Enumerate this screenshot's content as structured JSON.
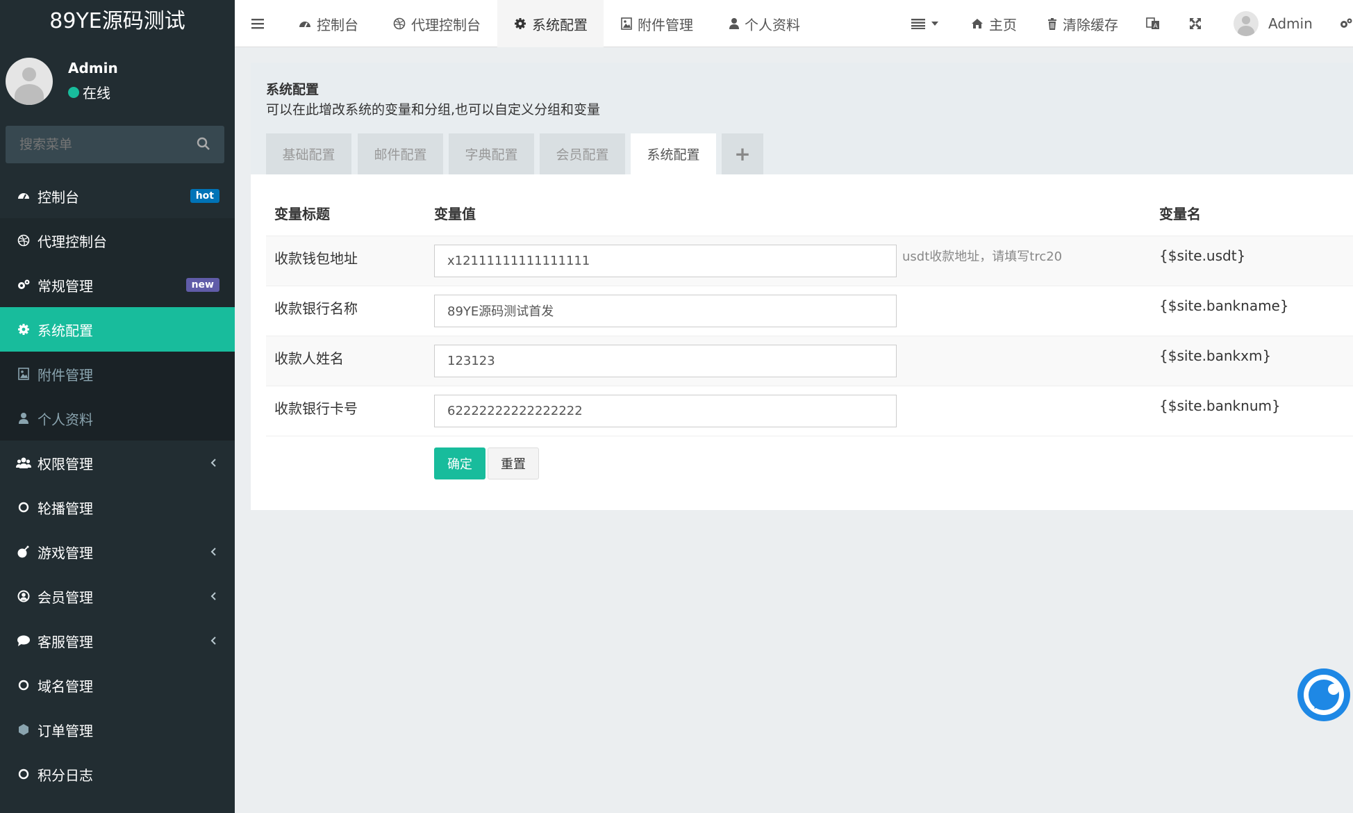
{
  "app": {
    "logo": "89YE源码测试"
  },
  "user": {
    "name": "Admin",
    "status": "在线"
  },
  "search": {
    "placeholder": "搜索菜单"
  },
  "sidebar": {
    "items": [
      {
        "label": "控制台",
        "badge": "hot",
        "badge_color": "#0073b7",
        "icon": "dashboard-icon"
      },
      {
        "label": "代理控制台",
        "icon": "dribbble-icon"
      },
      {
        "label": "常规管理",
        "badge": "new",
        "badge_color": "#605ca8",
        "icon": "cogs-icon"
      },
      {
        "label": "系统配置",
        "icon": "gear-icon"
      },
      {
        "label": "附件管理",
        "icon": "image-icon"
      },
      {
        "label": "个人资料",
        "icon": "user-icon"
      },
      {
        "label": "权限管理",
        "icon": "group-icon"
      },
      {
        "label": "轮播管理",
        "icon": "circle-icon"
      },
      {
        "label": "游戏管理",
        "icon": "bomb-icon"
      },
      {
        "label": "会员管理",
        "icon": "user-circle-icon"
      },
      {
        "label": "客服管理",
        "icon": "comment-icon"
      },
      {
        "label": "域名管理",
        "icon": "circle-icon"
      },
      {
        "label": "订单管理",
        "icon": "hexagon-icon"
      },
      {
        "label": "积分日志",
        "icon": "circle-icon"
      }
    ]
  },
  "topnav": {
    "items": [
      {
        "label": "控制台",
        "icon": "dashboard-icon"
      },
      {
        "label": "代理控制台",
        "icon": "dribbble-icon"
      },
      {
        "label": "系统配置",
        "icon": "gear-icon"
      },
      {
        "label": "附件管理",
        "icon": "image-icon"
      },
      {
        "label": "个人资料",
        "icon": "user-icon"
      }
    ],
    "home": "主页",
    "clear_cache": "清除缓存",
    "admin": "Admin"
  },
  "page": {
    "title": "系统配置",
    "description": "可以在此增改系统的变量和分组,也可以自定义分组和变量"
  },
  "tabs": [
    "基础配置",
    "邮件配置",
    "字典配置",
    "会员配置",
    "系统配置",
    "+"
  ],
  "table": {
    "headers": [
      "变量标题",
      "变量值",
      "变量名"
    ],
    "rows": [
      {
        "title": "收款钱包地址",
        "value": "x12111111111111111",
        "tip": "usdt收款地址，请填写trc20",
        "name": "{$site.usdt}"
      },
      {
        "title": "收款银行名称",
        "value": "89YE源码测试首发",
        "tip": "",
        "name": "{$site.bankname}"
      },
      {
        "title": "收款人姓名",
        "value": "123123",
        "tip": "",
        "name": "{$site.bankxm}"
      },
      {
        "title": "收款银行卡号",
        "value": "62222222222222222",
        "tip": "",
        "name": "{$site.banknum}"
      }
    ]
  },
  "buttons": {
    "submit": "确定",
    "reset": "重置"
  },
  "colors": {
    "accent": "#18bc9c",
    "sidebar": "#222d32",
    "chat": "#1e88e5"
  }
}
